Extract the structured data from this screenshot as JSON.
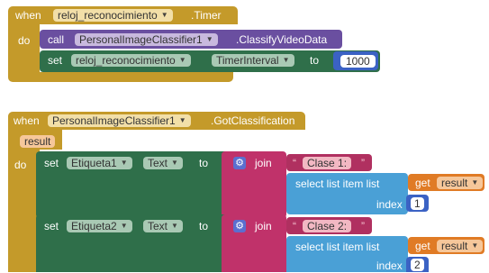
{
  "block1": {
    "when": "when",
    "timer_component": "reloj_reconocimiento",
    "timer_event": ".Timer",
    "do": "do",
    "call": "call",
    "classifier_component": "PersonalImageClassifier1",
    "classify_method": ".ClassifyVideoData",
    "set": "set",
    "set_component": "reloj_reconocimiento",
    "set_property": "TimerInterval",
    "to": "to",
    "interval_value": "1000"
  },
  "block2": {
    "when": "when",
    "component": "PersonalImageClassifier1",
    "event": ".GotClassification",
    "param": "result",
    "do": "do",
    "rows": [
      {
        "set": "set",
        "component": "Etiqueta1",
        "property": "Text",
        "to": "to",
        "join": "join",
        "string": "Clase 1: ",
        "select": "select list item  list",
        "get": "get",
        "var": "result",
        "index_label": "index",
        "index_value": "1"
      },
      {
        "set": "set",
        "component": "Etiqueta2",
        "property": "Text",
        "to": "to",
        "join": "join",
        "string": "Clase 2: ",
        "select": "select list item  list",
        "get": "get",
        "var": "result",
        "index_label": "index",
        "index_value": "2"
      }
    ]
  },
  "colors": {
    "event_gold": "#c49a2a",
    "procedure_purple": "#6a4fa0",
    "setter_green": "#2f6f4a",
    "list_blue": "#4aa0d6",
    "text_magenta": "#c0326a",
    "variable_orange": "#e07b25",
    "number_navy": "#3b62c4"
  }
}
